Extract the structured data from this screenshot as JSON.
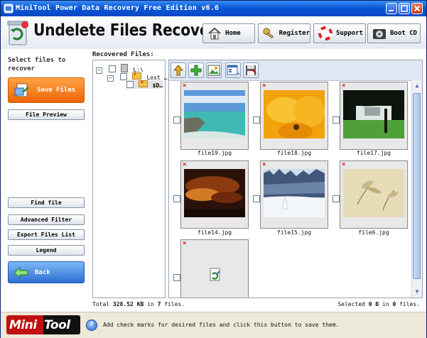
{
  "window": {
    "title": "MiniTool Power Data Recovery Free Edition v6.6"
  },
  "header": {
    "app_title": "Undelete Files Recovery"
  },
  "nav": {
    "home": "Home",
    "register": "Register",
    "support": "Support",
    "boot_cd": "Boot CD"
  },
  "left_panel": {
    "title": "Select files to recover",
    "save_files": "Save Files",
    "file_preview": "File Preview",
    "find_file": "Find file",
    "advanced_filter": "Advanced Filter",
    "export_files_list": "Export Files List",
    "legend": "Legend",
    "back": "Back"
  },
  "content": {
    "recovered_label": "Recovered Files:",
    "tree": [
      {
        "label": "L:\\"
      },
      {
        "label": "Lost …"
      },
      {
        "label": "$D…"
      }
    ],
    "files": [
      {
        "name": "file19.jpg"
      },
      {
        "name": "file18.jpg"
      },
      {
        "name": "file17.jpg"
      },
      {
        "name": "file14.jpg"
      },
      {
        "name": "file15.jpg"
      },
      {
        "name": "file6.jpg"
      },
      {
        "name": ""
      }
    ]
  },
  "status": {
    "total_prefix": "Total",
    "total_size": "328.52 KB",
    "total_mid": "in",
    "total_count": "7",
    "total_suffix": "files.",
    "selected_prefix": "Selected",
    "selected_size": "0 B",
    "selected_mid": "in",
    "selected_count": "0",
    "selected_suffix": "files."
  },
  "footer": {
    "logo_left": "Mini",
    "logo_right": "Tool",
    "hint": "Add check marks for desired files and click this button to save them."
  },
  "colors": {
    "accent_orange": "#ee6508",
    "accent_blue": "#2c6fd3",
    "title_blue": "#0a58d8",
    "brand_red": "#c11010"
  }
}
